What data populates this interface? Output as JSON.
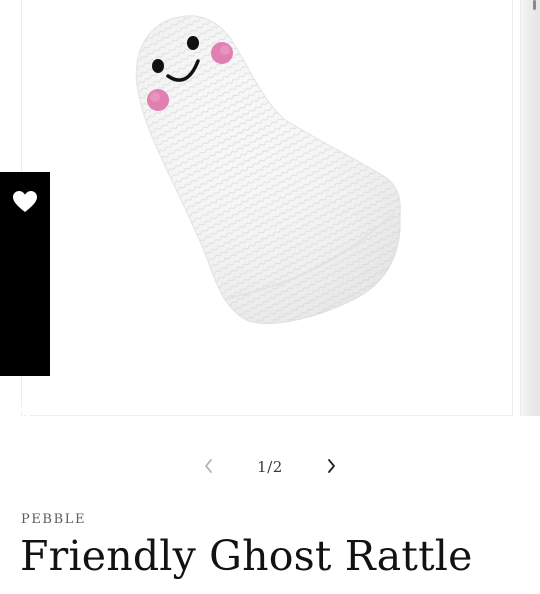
{
  "wishlist": {
    "label": "My Wishlist",
    "icon": "heart-icon"
  },
  "gallery": {
    "image_alt": "Crocheted white ghost rattle with a smiling face and pink cheeks",
    "counter": "1/2",
    "prev_icon": "chevron-left-icon",
    "next_icon": "chevron-right-icon"
  },
  "product": {
    "vendor": "PEBBLE",
    "title": "Friendly Ghost Rattle"
  },
  "colors": {
    "wishlist_bg": "#000000",
    "cheek_pink": "#e07fb0",
    "text": "#121212"
  }
}
